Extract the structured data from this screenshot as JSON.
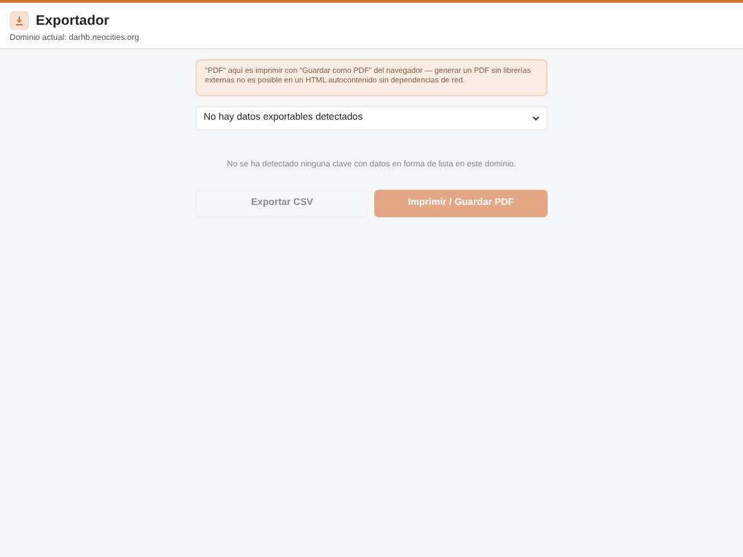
{
  "header": {
    "title": "Exportador",
    "domain": "Dominio actual: darhb.neocities.org"
  },
  "notice": "\"PDF\" aquí es imprimir con \"Guardar como PDF\" del navegador — generar un PDF sin librerías externas no es posible en un HTML autocontenido sin dependencias de red.",
  "select": {
    "value": "No hay datos exportables detectados"
  },
  "empty_message": "No se ha detectado ninguna clave con datos en forma de lista en este dominio.",
  "buttons": [
    {
      "label": "Exportar CSV",
      "kind": "secondary",
      "disabled": true
    },
    {
      "label": "Imprimir / Guardar PDF",
      "kind": "primary",
      "disabled": true
    }
  ]
}
